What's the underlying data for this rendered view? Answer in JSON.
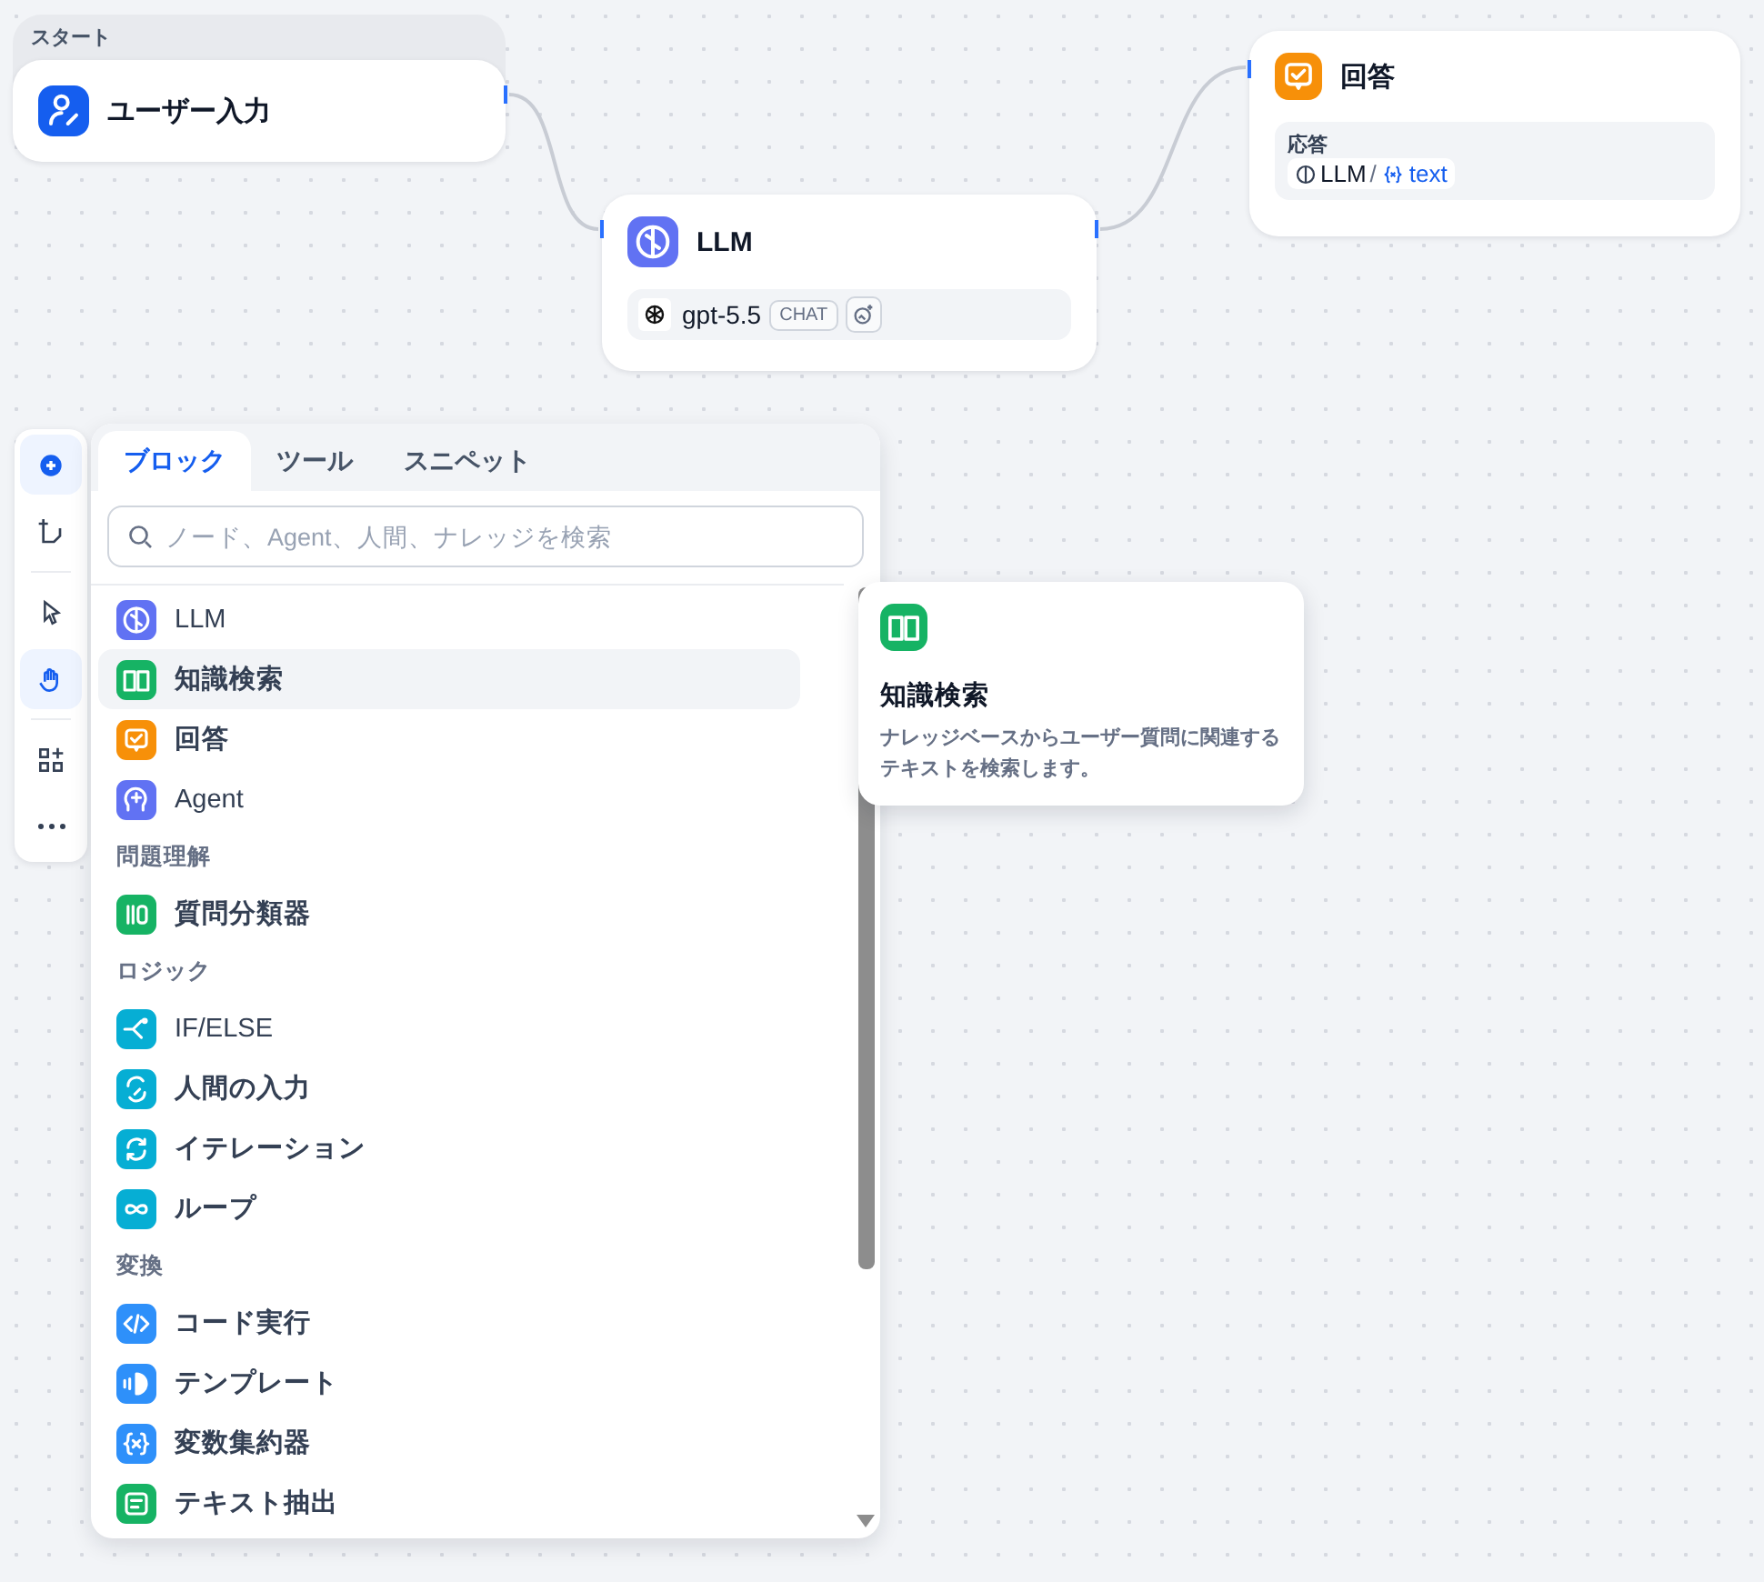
{
  "nodes": [
    {
      "kind": "start",
      "group_label": "スタート",
      "title": "ユーザー入力"
    },
    {
      "kind": "llm",
      "title": "LLM",
      "model": "gpt-5.5",
      "model_tag": "CHAT"
    },
    {
      "kind": "answer",
      "title": "回答",
      "field_label": "応答",
      "source": "LLM",
      "separator": "/",
      "variable": "text"
    }
  ],
  "toolbar": [
    {
      "selected": true
    },
    {
      "selected": false
    },
    {
      "selected": false
    },
    {
      "selected": true
    },
    {
      "selected": false
    },
    {
      "selected": false
    }
  ],
  "block_panel": {
    "tabs": [
      {
        "label": "ブロック",
        "selected": true
      },
      {
        "label": "ツール",
        "selected": false
      },
      {
        "label": "スニペット",
        "selected": false
      }
    ],
    "search": {
      "placeholder": "ノード、Agent、人間、ナレッジを検索"
    },
    "items": [
      {
        "kind": "item",
        "label": "LLM",
        "color": "#6172f3",
        "selected": false
      },
      {
        "kind": "item",
        "label": "知識検索",
        "color": "#16b364",
        "selected": true
      },
      {
        "kind": "item",
        "label": "回答",
        "color": "#f79009",
        "selected": false
      },
      {
        "kind": "item",
        "label": "Agent",
        "color": "#6172f3",
        "selected": false
      },
      {
        "kind": "section",
        "label": "問題理解"
      },
      {
        "kind": "item",
        "label": "質問分類器",
        "color": "#16b364",
        "selected": false
      },
      {
        "kind": "section",
        "label": "ロジック"
      },
      {
        "kind": "item",
        "label": "IF/ELSE",
        "color": "#06aed4",
        "selected": false
      },
      {
        "kind": "item",
        "label": "人間の入力",
        "color": "#06aed4",
        "selected": false
      },
      {
        "kind": "item",
        "label": "イテレーション",
        "color": "#06aed4",
        "selected": false
      },
      {
        "kind": "item",
        "label": "ループ",
        "color": "#06aed4",
        "selected": false
      },
      {
        "kind": "section",
        "label": "変換"
      },
      {
        "kind": "item",
        "label": "コード実行",
        "color": "#2e90fa",
        "selected": false
      },
      {
        "kind": "item",
        "label": "テンプレート",
        "color": "#2e90fa",
        "selected": false
      },
      {
        "kind": "item",
        "label": "変数集約器",
        "color": "#2e90fa",
        "selected": false
      },
      {
        "kind": "item",
        "label": "テキスト抽出",
        "color": "#16b364",
        "selected": false
      }
    ]
  },
  "tooltip": {
    "title": "知識検索",
    "description": "ナレッジベースからユーザー質問に関連するテキストを検索します。",
    "color": "#16b364"
  }
}
